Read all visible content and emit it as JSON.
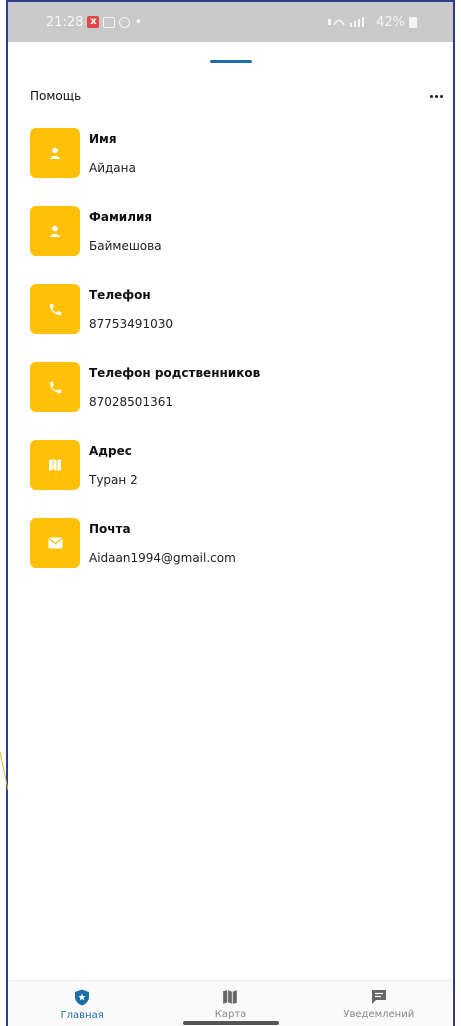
{
  "status_bar": {
    "time": "21:28",
    "dot": "•",
    "right_text": "42%"
  },
  "header": {
    "title": "Помощь"
  },
  "profile": [
    {
      "label": "Имя",
      "value": "Айдана",
      "icon": "person-icon"
    },
    {
      "label": "Фамилия",
      "value": "Баймешова",
      "icon": "person-icon"
    },
    {
      "label": "Телефон",
      "value": "87753491030",
      "icon": "phone-icon"
    },
    {
      "label": "Телефон родственников",
      "value": "87028501361",
      "icon": "phone-icon"
    },
    {
      "label": "Адрес",
      "value": "Туран 2",
      "icon": "map-icon"
    },
    {
      "label": "Почта",
      "value": "Aidaan1994@gmail.com",
      "icon": "mail-icon"
    }
  ],
  "bottom_nav": [
    {
      "label": "Главная",
      "icon": "shield-icon",
      "active": true
    },
    {
      "label": "Карта",
      "icon": "map-icon",
      "active": false
    },
    {
      "label": "Уведемлений",
      "icon": "message-icon",
      "active": false
    }
  ],
  "colors": {
    "accent": "#ffc107",
    "primary": "#1f6fa6",
    "status_bar": "#c9c9c9"
  }
}
